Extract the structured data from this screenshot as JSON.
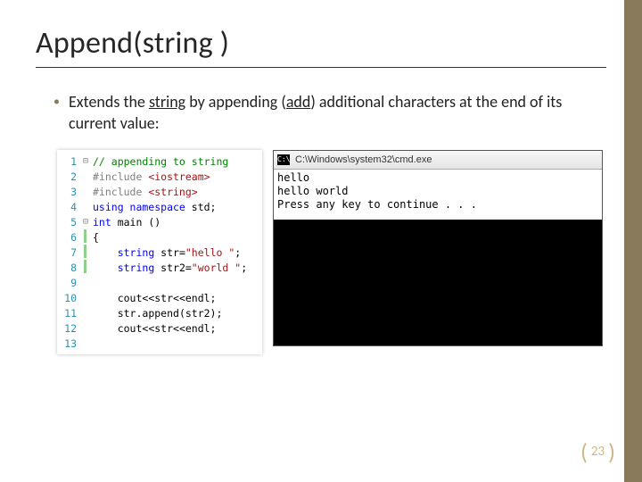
{
  "title": "Append(string )",
  "bullet": {
    "pre": "Extends the ",
    "u1": "string",
    "mid": " by appending (",
    "u2": "add",
    "post": ") additional characters at the end of its current value:"
  },
  "code": {
    "lines": [
      {
        "n": "1",
        "fold": "⊟",
        "cls": "c-comment",
        "indent": "",
        "text": "// appending to string"
      },
      {
        "n": "2",
        "fold": "",
        "cls": "c-pp",
        "indent": "",
        "pp": "#include ",
        "lit": "<iostream>"
      },
      {
        "n": "3",
        "fold": "",
        "cls": "c-pp",
        "indent": "",
        "pp": "#include ",
        "lit": "<string>"
      },
      {
        "n": "4",
        "fold": "",
        "cls": "c-kw",
        "indent": "",
        "kw": "using namespace",
        "rest": " std;"
      },
      {
        "n": "5",
        "fold": "⊟",
        "cls": "",
        "indent": "",
        "kw": "int",
        "rest": " main ()"
      },
      {
        "n": "6",
        "fold": "",
        "cls": "c-plain",
        "indent": "",
        "text": "{",
        "mark": true
      },
      {
        "n": "7",
        "fold": "",
        "cls": "",
        "indent": "    ",
        "kw": "string",
        "rest": " str=",
        "str": "\"hello \"",
        "tail": ";",
        "mark": true
      },
      {
        "n": "8",
        "fold": "",
        "cls": "",
        "indent": "    ",
        "kw": "string",
        "rest": " str2=",
        "str": "\"world \"",
        "tail": ";",
        "mark": true
      },
      {
        "n": "9",
        "fold": "",
        "cls": "c-plain",
        "indent": "",
        "text": ""
      },
      {
        "n": "10",
        "fold": "",
        "cls": "c-plain",
        "indent": "    ",
        "text": "cout<<str<<endl;"
      },
      {
        "n": "11",
        "fold": "",
        "cls": "c-plain",
        "indent": "    ",
        "text": "str.append(str2);"
      },
      {
        "n": "12",
        "fold": "",
        "cls": "c-plain",
        "indent": "    ",
        "text": "cout<<str<<endl;"
      },
      {
        "n": "13",
        "fold": "",
        "cls": "c-plain",
        "indent": "",
        "text": ""
      }
    ]
  },
  "console": {
    "icon": "C:\\",
    "title": "C:\\Windows\\system32\\cmd.exe",
    "out1": "hello",
    "out2": "hello world",
    "out3": "Press any key to continue . . ."
  },
  "page_number": "23"
}
